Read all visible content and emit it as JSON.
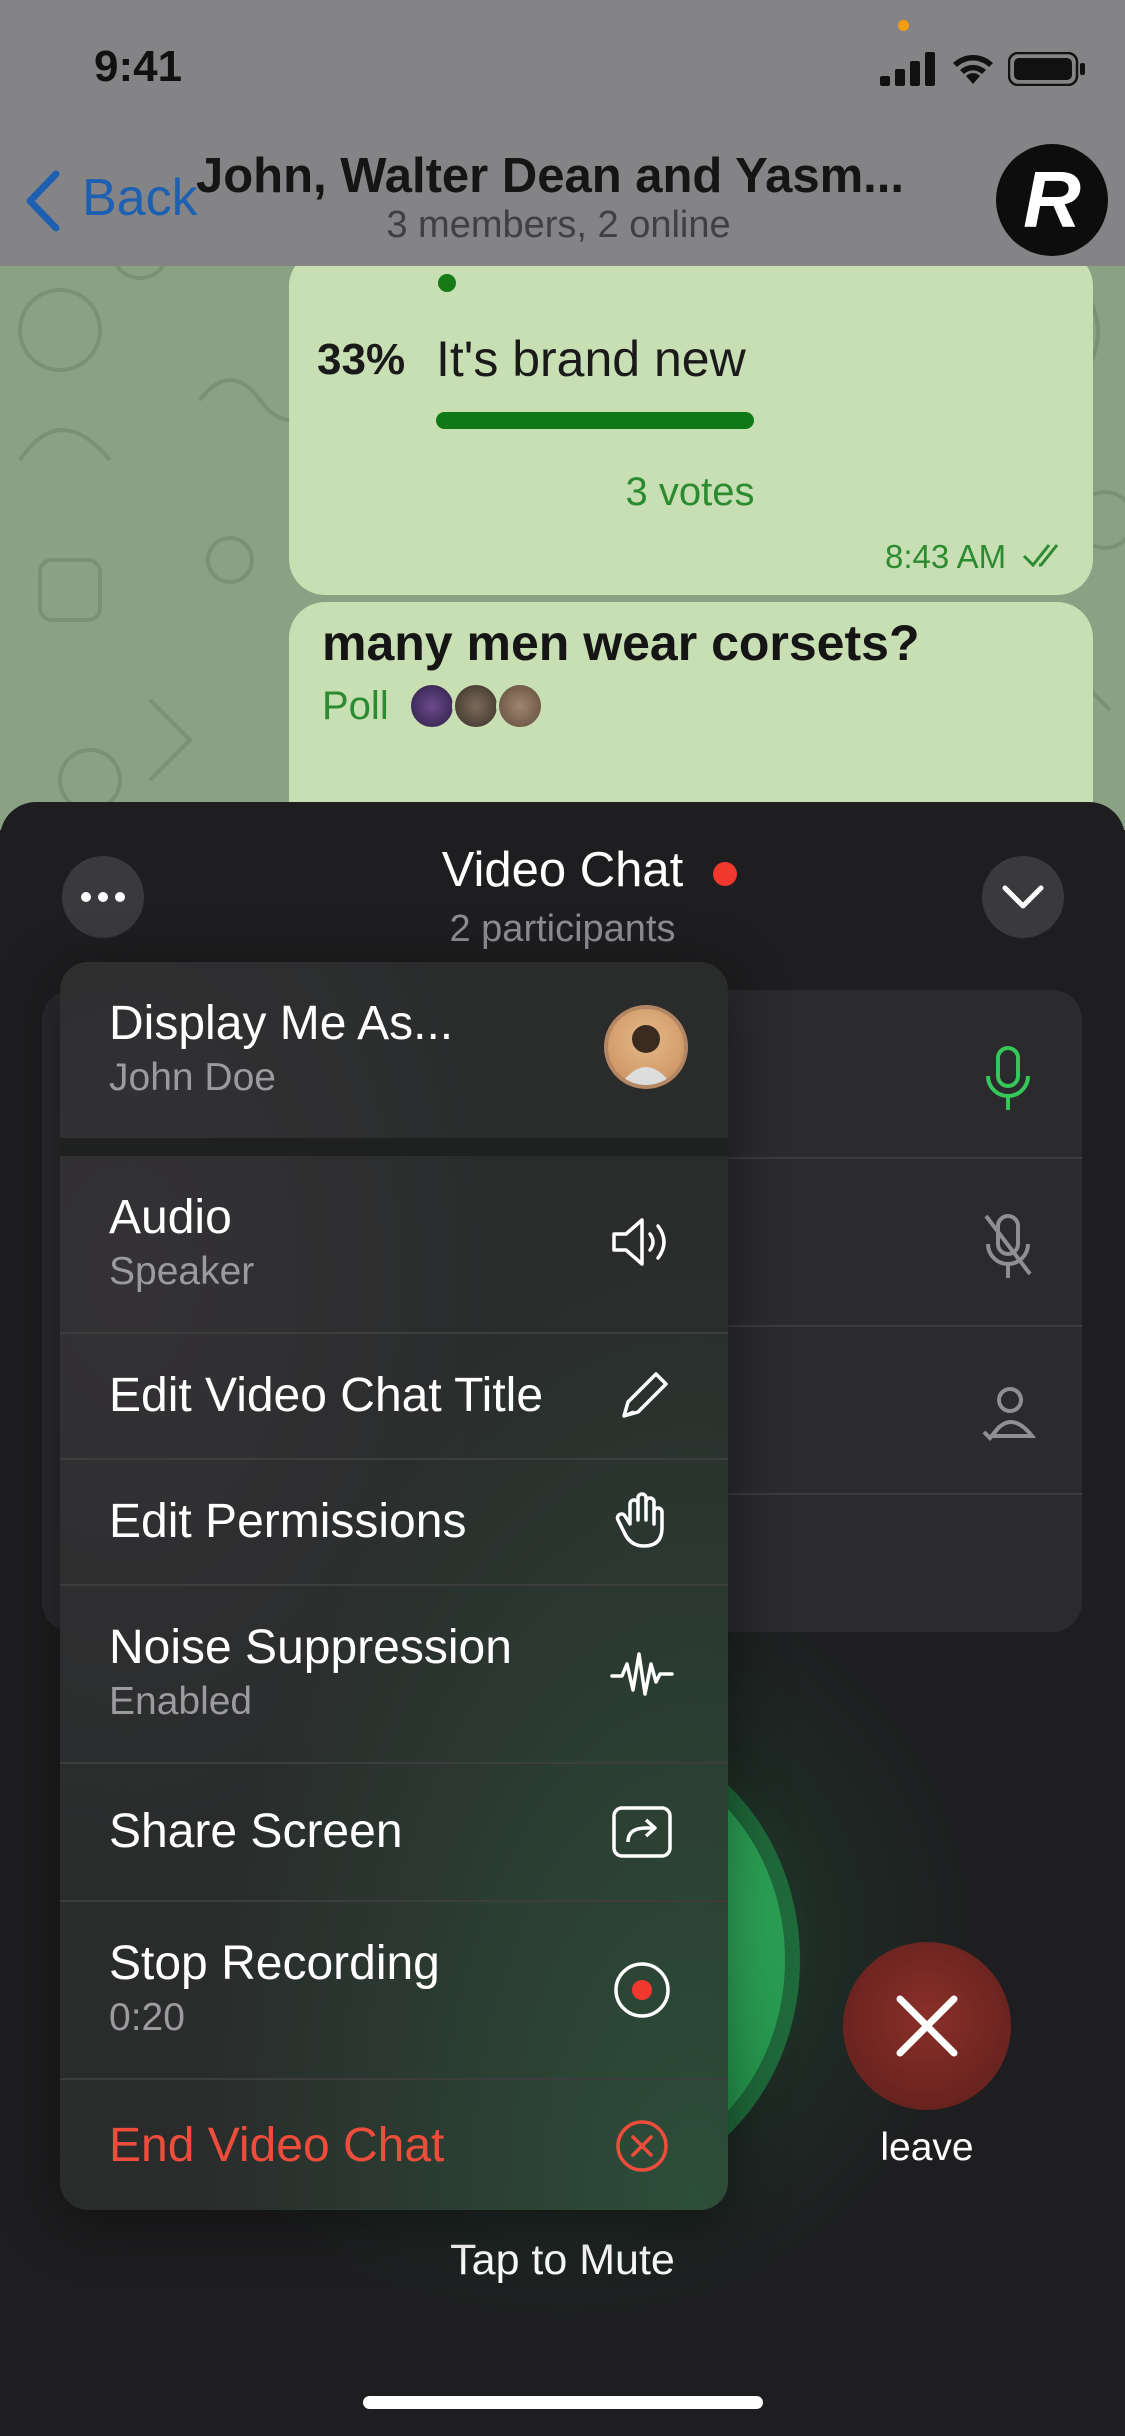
{
  "status_bar": {
    "time": "9:41"
  },
  "nav": {
    "back_label": "Back",
    "title": "John, Walter Dean and Yasm...",
    "subtitle": "3 members, 2 online",
    "avatar_letter": "R"
  },
  "chat": {
    "poll_option": {
      "percent": "33%",
      "text": "It's brand new",
      "progress_fraction": 0.33
    },
    "votes": "3 votes",
    "message_time": "8:43 AM",
    "next_poll_question": "many men wear corsets?",
    "next_poll_label": "Poll"
  },
  "video_chat": {
    "title": "Video Chat",
    "participants": "2 participants",
    "leave_label": "leave",
    "tap_label": "Tap to Mute"
  },
  "menu": {
    "display_as": {
      "label": "Display Me As...",
      "sub": "John Doe"
    },
    "audio": {
      "label": "Audio",
      "sub": "Speaker"
    },
    "edit_title": {
      "label": "Edit Video Chat Title"
    },
    "edit_permissions": {
      "label": "Edit Permissions"
    },
    "noise": {
      "label": "Noise Suppression",
      "sub": "Enabled"
    },
    "share_screen": {
      "label": "Share Screen"
    },
    "stop_recording": {
      "label": "Stop Recording",
      "sub": "0:20"
    },
    "end_chat": {
      "label": "End Video Chat"
    }
  },
  "colors": {
    "accent_blue": "#1d5fb0",
    "poll_green": "#0f7a15",
    "recording_red": "#f0382f",
    "danger": "#ef4d3b",
    "mic_green": "#35c759"
  }
}
